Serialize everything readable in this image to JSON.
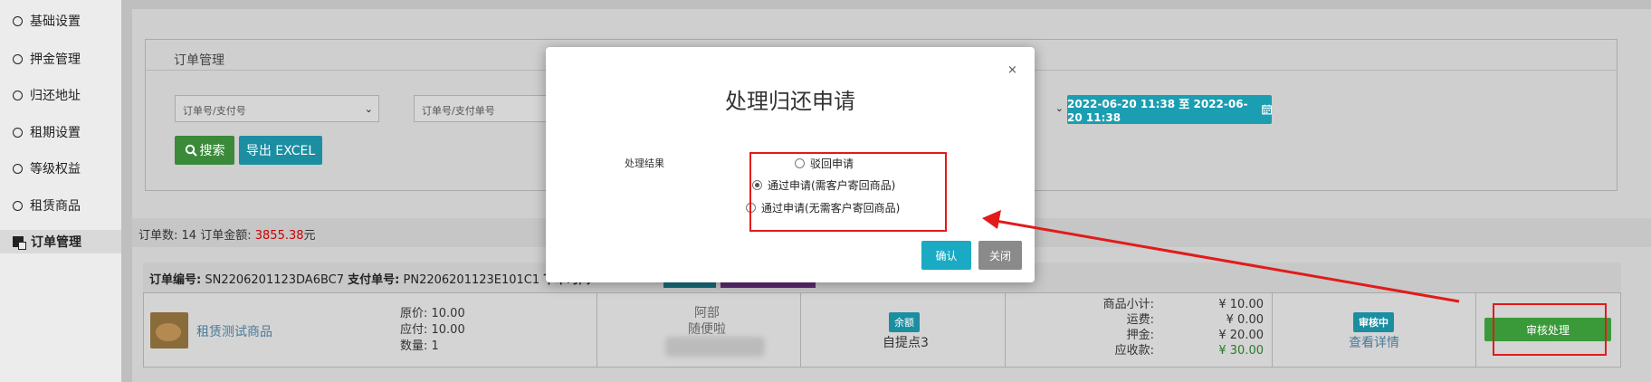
{
  "sidebar": {
    "items": [
      {
        "label": "基础设置",
        "active": false
      },
      {
        "label": "押金管理",
        "active": false
      },
      {
        "label": "归还地址",
        "active": false
      },
      {
        "label": "租期设置",
        "active": false
      },
      {
        "label": "等级权益",
        "active": false
      },
      {
        "label": "租赁商品",
        "active": false
      },
      {
        "label": "订单管理",
        "active": true
      }
    ]
  },
  "panel": {
    "title": "订单管理",
    "select1_placeholder": "订单号/支付号",
    "input2_placeholder": "订单号/支付单号",
    "date_range": "2022-06-20 11:38 至 2022-06-20 11:38",
    "search_label": "搜索",
    "export_label": "导出 EXCEL"
  },
  "summary": {
    "count_prefix": "订单数:",
    "count": "14",
    "amount_prefix": "订单金额:",
    "amount": "3855.38",
    "amount_suffix": "元"
  },
  "order": {
    "no_label": "订单编号:",
    "no": "SN2206201123DA6BC7",
    "pay_label": "支付单号:",
    "pay_no": "PN2206201123E101C1",
    "time_label": "下单时间",
    "product_name": "租赁测试商品",
    "original_price": "原价: 10.00",
    "payable": "应付: 10.00",
    "quantity": "数量: 1",
    "buyer_name": "阿部",
    "buyer_note": "随便啦",
    "pay_badge": "余额",
    "pickup": "自提点3",
    "fee_labels": [
      "商品小计:",
      "运费:",
      "押金:",
      "应收款:"
    ],
    "fee_values": [
      "¥ 10.00",
      "¥ 0.00",
      "¥ 20.00",
      "¥ 30.00"
    ],
    "status_badge": "审核中",
    "detail_link": "查看详情",
    "process_button": "审核处理"
  },
  "modal": {
    "close": "×",
    "title": "处理归还申请",
    "field_label": "处理结果",
    "options": [
      {
        "label": "驳回申请",
        "checked": false
      },
      {
        "label": "通过申请(需客户寄回商品)",
        "checked": true
      },
      {
        "label": "通过申请(无需客户寄回商品)",
        "checked": false
      }
    ],
    "confirm": "确认",
    "close_button": "关闭"
  },
  "colors": {
    "highlight_red": "#e21b1b",
    "teal": "#1aaac3",
    "green": "#3a9a3a",
    "price_red": "#c00000"
  }
}
